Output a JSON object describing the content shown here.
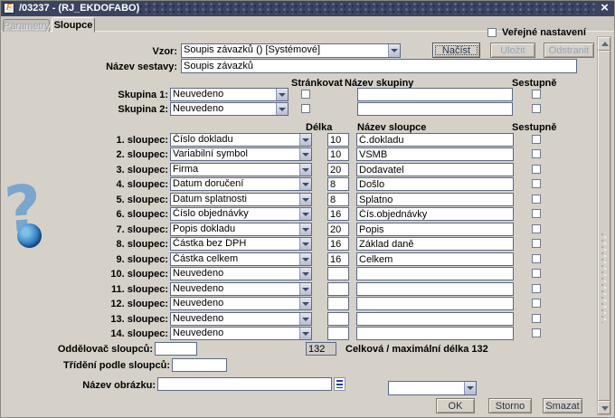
{
  "window": {
    "title": "/03237 - (RJ_EKDOFABO)"
  },
  "icons": {
    "app": "F",
    "close": "×",
    "question_mark": "?"
  },
  "tabs": [
    {
      "label": "Parametry",
      "active": false
    },
    {
      "label": "Sloupce",
      "active": true
    }
  ],
  "toolbar": {
    "vzor_label": "Vzor:",
    "vzor_value": "Soupis závazků  ()  [Systémové]",
    "nacist_button": "Načíst",
    "ulozit_button": "Uložit",
    "odstranit_button": "Odstranit",
    "verejne_nastaveni_label": "Veřejné nastavení",
    "verejne_nastaveni_checked": false,
    "nazev_sestavy_label": "Název sestavy:",
    "nazev_sestavy_value": "Soupis závazků"
  },
  "groups": {
    "headers": {
      "strankovat": "Stránkovat",
      "nazev_skupiny": "Název skupiny",
      "sestupne": "Sestupně"
    },
    "rows": [
      {
        "label": "Skupina 1:",
        "type": "Neuvedeno",
        "strankovat_checked": false,
        "name": "",
        "sestupne_checked": false
      },
      {
        "label": "Skupina 2:",
        "type": "Neuvedeno",
        "strankovat_checked": false,
        "name": "",
        "sestupne_checked": false
      }
    ]
  },
  "columns": {
    "headers": {
      "delka": "Délka",
      "nazev_sloupce": "Název sloupce",
      "sestupne": "Sestupně"
    },
    "rows": [
      {
        "label": "1. sloupec:",
        "type": "Číslo dokladu",
        "len": "10",
        "name": "Č.dokladu",
        "sestupne_checked": false
      },
      {
        "label": "2. sloupec:",
        "type": "Variabilní symbol",
        "len": "10",
        "name": "VSMB",
        "sestupne_checked": false
      },
      {
        "label": "3. sloupec:",
        "type": "Firma",
        "len": "20",
        "name": "Dodavatel",
        "sestupne_checked": false
      },
      {
        "label": "4. sloupec:",
        "type": "Datum doručení",
        "len": "8",
        "name": "Došlo",
        "sestupne_checked": false
      },
      {
        "label": "5. sloupec:",
        "type": "Datum splatnosti",
        "len": "8",
        "name": "Splatno",
        "sestupne_checked": false
      },
      {
        "label": "6. sloupec:",
        "type": "Číslo objednávky",
        "len": "16",
        "name": "Čís.objednávky",
        "sestupne_checked": false
      },
      {
        "label": "7. sloupec:",
        "type": "Popis dokladu",
        "len": "20",
        "name": "Popis",
        "sestupne_checked": false
      },
      {
        "label": "8. sloupec:",
        "type": "Částka bez DPH",
        "len": "16",
        "name": "Základ daně",
        "sestupne_checked": false
      },
      {
        "label": "9. sloupec:",
        "type": "Částka celkem",
        "len": "16",
        "name": "Celkem",
        "sestupne_checked": false
      },
      {
        "label": "10. sloupec:",
        "type": "Neuvedeno",
        "len": "",
        "name": "",
        "sestupne_checked": false
      },
      {
        "label": "11. sloupec:",
        "type": "Neuvedeno",
        "len": "",
        "name": "",
        "sestupne_checked": false
      },
      {
        "label": "12. sloupec:",
        "type": "Neuvedeno",
        "len": "",
        "name": "",
        "sestupne_checked": false
      },
      {
        "label": "13. sloupec:",
        "type": "Neuvedeno",
        "len": "",
        "name": "",
        "sestupne_checked": false
      },
      {
        "label": "14. sloupec:",
        "type": "Neuvedeno",
        "len": "",
        "name": "",
        "sestupne_checked": false
      }
    ]
  },
  "footer": {
    "oddelovac_label": "Oddělovač sloupců:",
    "oddelovac_value": "",
    "total_value": "132",
    "total_label": "Celková / maximální délka 132",
    "trideni_label": "Třídění podle sloupců:",
    "trideni_value": "",
    "obrazek_label": "Název obrázku:",
    "obrazek_value": "",
    "obrazek_combo_value": "",
    "ok_button": "OK",
    "storno_button": "Storno",
    "smazat_button": "Smazat"
  },
  "colors": {
    "titlebar": "#3a4460",
    "window_bg": "#d5d1c9",
    "field_border": "#5b6985",
    "accent_blue": "#2e7cc0"
  }
}
